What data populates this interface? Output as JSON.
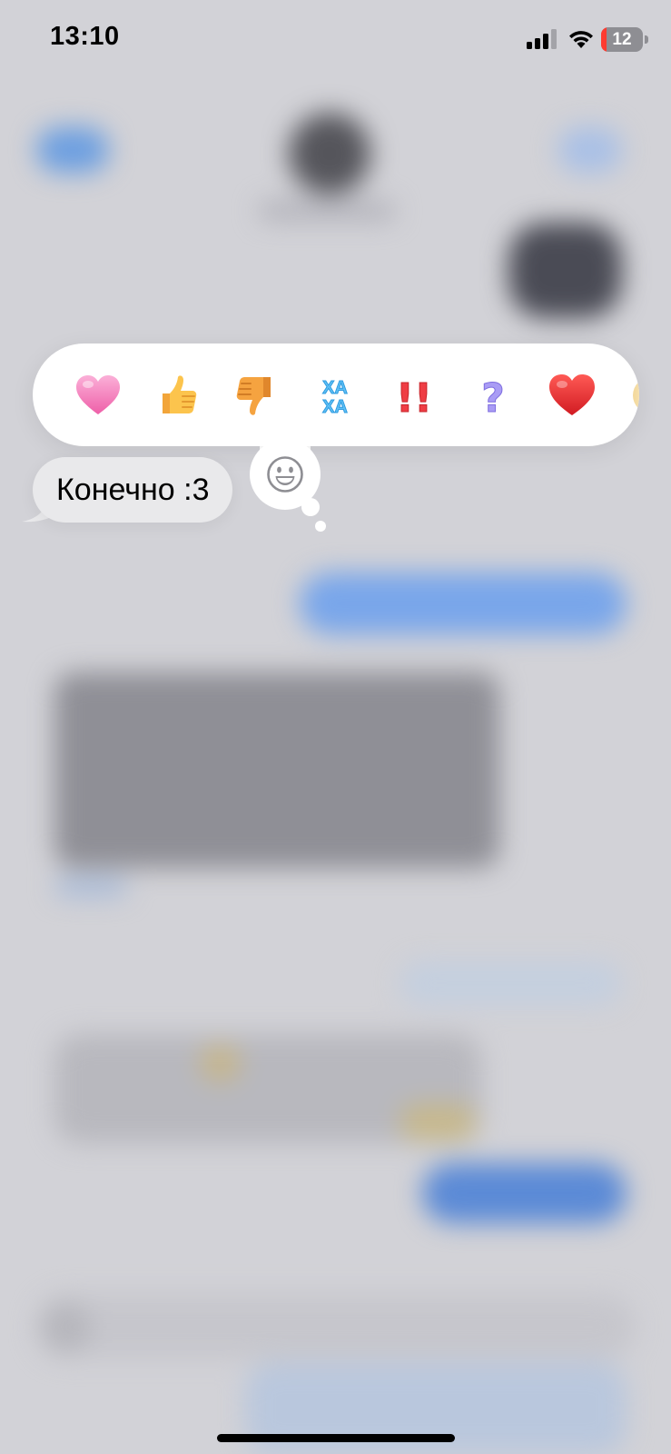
{
  "status_bar": {
    "time": "13:10",
    "battery_level": "12",
    "battery_fraction": 0.12,
    "icons": [
      "signal-icon",
      "wifi-icon",
      "battery-icon"
    ]
  },
  "reaction_bar": {
    "items": [
      {
        "name": "pink-heart",
        "icon": "pink-heart-icon"
      },
      {
        "name": "thumbs-up",
        "icon": "thumbs-up-icon"
      },
      {
        "name": "thumbs-down",
        "icon": "thumbs-down-icon"
      },
      {
        "name": "haha",
        "icon": "haha-icon",
        "text": [
          "ХА",
          "ХА"
        ]
      },
      {
        "name": "exclamation",
        "icon": "double-exclamation-icon",
        "text": "!!"
      },
      {
        "name": "question",
        "icon": "question-mark-icon",
        "text": "?"
      },
      {
        "name": "red-heart",
        "icon": "red-heart-icon"
      },
      {
        "name": "more-emoji",
        "icon": "partial-emoji-icon"
      }
    ],
    "picker_icon": "smiley-icon"
  },
  "message": {
    "text": "Конечно :3",
    "direction": "incoming"
  },
  "colors": {
    "bubble_incoming": "#e9e9eb",
    "overlay": "#d2d2d7",
    "battery_low": "#ff3b30",
    "heart_red": "#e0242b",
    "heart_pink": "#f47ab9",
    "haha_blue": "#5ec0f5",
    "exclamation_red": "#ef3d44",
    "question_purple": "#9a8df0"
  }
}
